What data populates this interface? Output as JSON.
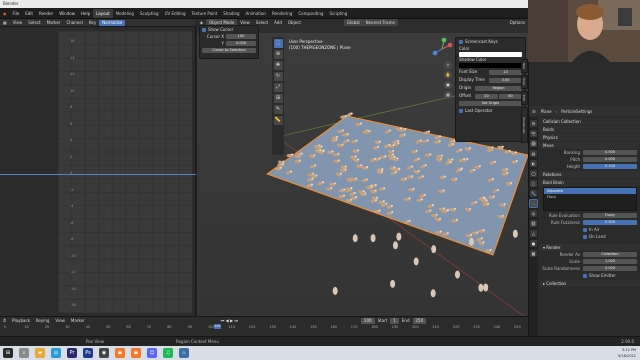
{
  "window": {
    "title": "Blender"
  },
  "menubar": {
    "menus": [
      "File",
      "Edit",
      "Render",
      "Window",
      "Help"
    ],
    "workspaces": [
      "Layout",
      "Modeling",
      "Sculpting",
      "UV Editing",
      "Texture Paint",
      "Shading",
      "Animation",
      "Rendering",
      "Compositing",
      "Scripting"
    ],
    "active_workspace": "Layout"
  },
  "uv_editor": {
    "menus": [
      "View",
      "Select",
      "Marker",
      "Channel",
      "Key"
    ],
    "mode": "Normalize",
    "y_ticks": [
      "16",
      "14",
      "12",
      "10",
      "8",
      "6",
      "4",
      "2",
      "0",
      "-2",
      "-4",
      "-6",
      "-8",
      "-10",
      "-12",
      "-14",
      "-16"
    ]
  },
  "viewport": {
    "mode": "Object Mode",
    "menus": [
      "View",
      "Select",
      "Add",
      "Object"
    ],
    "snap": "Nearest Frame",
    "transform": "Global",
    "options": "Options",
    "title_line1": "User Perspective",
    "title_line2": "(100) THEPIGEONZONE | Plane",
    "cursor_panel": {
      "show_label": "Show Cursor",
      "x_label": "Cursor X",
      "x_value": "100",
      "y_label": "Y",
      "y_value": "0.000",
      "button": "Cursor to Selection"
    },
    "screencast": {
      "title": "Screencast Keys",
      "color_label": "Color",
      "color_hex": "#ffffff",
      "shadow_label": "Shadow Color",
      "shadow_hex": "#000000",
      "font_size_label": "Font Size",
      "font_size": "13",
      "display_time_label": "Display Time",
      "display_time": "3.00",
      "origin_label": "Origin",
      "origin_value": "Region",
      "offset_label": "Offset",
      "offset_x": "20",
      "offset_y": "80",
      "set_origin": "Set Origin",
      "last_operator": "Last Operator"
    },
    "side_tabs": [
      "Tool",
      "View",
      "Edit",
      "Screencast"
    ]
  },
  "properties": {
    "object": "Plane",
    "psys": "ParticleSettings",
    "rows": [
      {
        "type": "sec",
        "label": "Collision Collection"
      },
      {
        "type": "sec",
        "label": "Boids"
      },
      {
        "type": "sec",
        "label": "Physics"
      },
      {
        "type": "sec",
        "label": "Move"
      },
      {
        "type": "kv",
        "k": "Banking",
        "v": "0.000"
      },
      {
        "type": "kv",
        "k": "Pitch",
        "v": "0.000"
      },
      {
        "type": "kv",
        "k": "Height",
        "v": "0.100",
        "blue": true
      },
      {
        "type": "sec",
        "label": "Relations"
      },
      {
        "type": "sec",
        "label": "Boid Brain"
      }
    ],
    "list_items": [
      "Separate",
      "Flock"
    ],
    "rule_eval_label": "Rule Evaluation",
    "rule_eval_value": "Fuzzy",
    "rule_fuzzy_label": "Rule Fuzziness",
    "rule_fuzzy_value": "0.500",
    "in_air": "In Air",
    "on_land": "On Land",
    "render_section": "Render",
    "render_as_label": "Render As",
    "render_as_value": "Collection",
    "scale_label": "Scale",
    "scale_value": "1.000",
    "scale_rand_label": "Scale Randomness",
    "scale_rand_value": "0.000",
    "show_emitter": "Show Emitter",
    "collection_section": "Collection"
  },
  "timeline": {
    "menus": [
      "Playback",
      "Keying",
      "View",
      "Marker"
    ],
    "current_frame": "100",
    "start_label": "Start",
    "start_value": "1",
    "end_label": "End",
    "end_value": "250",
    "numbers": [
      "0",
      "10",
      "20",
      "30",
      "40",
      "50",
      "60",
      "70",
      "80",
      "90",
      "100",
      "110",
      "120",
      "130",
      "140",
      "150",
      "160",
      "170",
      "180",
      "190",
      "200",
      "210",
      "220",
      "230",
      "240",
      "250"
    ]
  },
  "statusbar": {
    "left": "Pan View",
    "middle": "Region Context Menu",
    "version": "2.90.0"
  },
  "taskbar": {
    "time": "3:12 PM",
    "date": "9/18/2021"
  },
  "colors": {
    "accent": "#4772b3",
    "selection_orange": "#ff8a1f",
    "plane": "#7f93ad"
  }
}
